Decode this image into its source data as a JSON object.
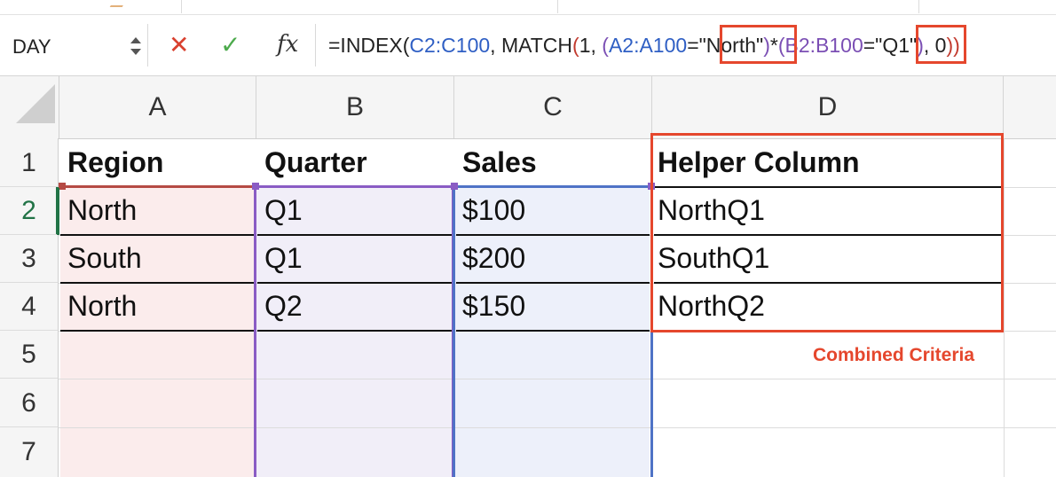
{
  "name_box": {
    "value": "DAY"
  },
  "formula_bar": {
    "cancel_icon": "✕",
    "enter_icon": "✓",
    "fx_label": "fx",
    "formula_parts": [
      {
        "text": "=INDEX(",
        "color": "default"
      },
      {
        "text": "C2:C100",
        "color": "blue"
      },
      {
        "text": ", MATCH",
        "color": "default"
      },
      {
        "text": "(",
        "color": "red"
      },
      {
        "text": "1, ",
        "color": "default"
      },
      {
        "text": "(",
        "color": "purple"
      },
      {
        "text": "A2:A100",
        "color": "blue"
      },
      {
        "text": "=\"North\"",
        "color": "default"
      },
      {
        "text": ")",
        "color": "purple"
      },
      {
        "text": "*",
        "color": "default"
      },
      {
        "text": "(",
        "color": "purple"
      },
      {
        "text": "B2:B100",
        "color": "purple"
      },
      {
        "text": "=\"Q1\"",
        "color": "default"
      },
      {
        "text": ")",
        "color": "purple"
      },
      {
        "text": ", 0",
        "color": "default"
      },
      {
        "text": "))",
        "color": "red"
      }
    ]
  },
  "columns": [
    "A",
    "B",
    "C",
    "D"
  ],
  "rows": [
    "1",
    "2",
    "3",
    "4",
    "5",
    "6",
    "7"
  ],
  "cells": {
    "header": [
      "Region",
      "Quarter",
      "Sales",
      "Helper Column"
    ],
    "data": [
      [
        "North",
        "Q1",
        "$100",
        "NorthQ1"
      ],
      [
        "South",
        "Q1",
        "$200",
        "SouthQ1"
      ],
      [
        "North",
        "Q2",
        "$150",
        "NorthQ2"
      ]
    ]
  },
  "annotation": {
    "callout": "Combined Criteria"
  },
  "colors": {
    "highlight_red": "#e5472d",
    "range_red": "#b54a44",
    "range_purple": "#8a5cc4",
    "range_blue": "#4f73c6",
    "formula_blue": "#2f5fc4",
    "formula_purple": "#7b4fb4",
    "formula_red": "#c23a2e",
    "active_row_green": "#217346"
  }
}
